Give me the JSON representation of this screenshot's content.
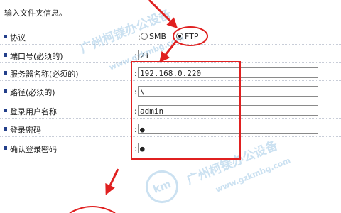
{
  "intro": "输入文件夹信息。",
  "protocol": {
    "label": "协议",
    "options": [
      "SMB",
      "FTP"
    ],
    "selected": "FTP"
  },
  "port": {
    "label": "端口号(必须的)",
    "value": "21"
  },
  "server": {
    "label": "服务器名称(必须的)",
    "value": "192.168.0.220"
  },
  "path": {
    "label": "路径(必须的)",
    "value": "\\"
  },
  "user": {
    "label": "登录用户名称",
    "value": "admin"
  },
  "password": {
    "label": "登录密码",
    "value": "●"
  },
  "confirm": {
    "label": "确认登录密码",
    "value": "●"
  },
  "colon": ":",
  "watermark": {
    "cn": "广州柯镁办公设备",
    "url": "www.gzkmbg.com",
    "logo": "km"
  },
  "annotation_color": "#e02020"
}
